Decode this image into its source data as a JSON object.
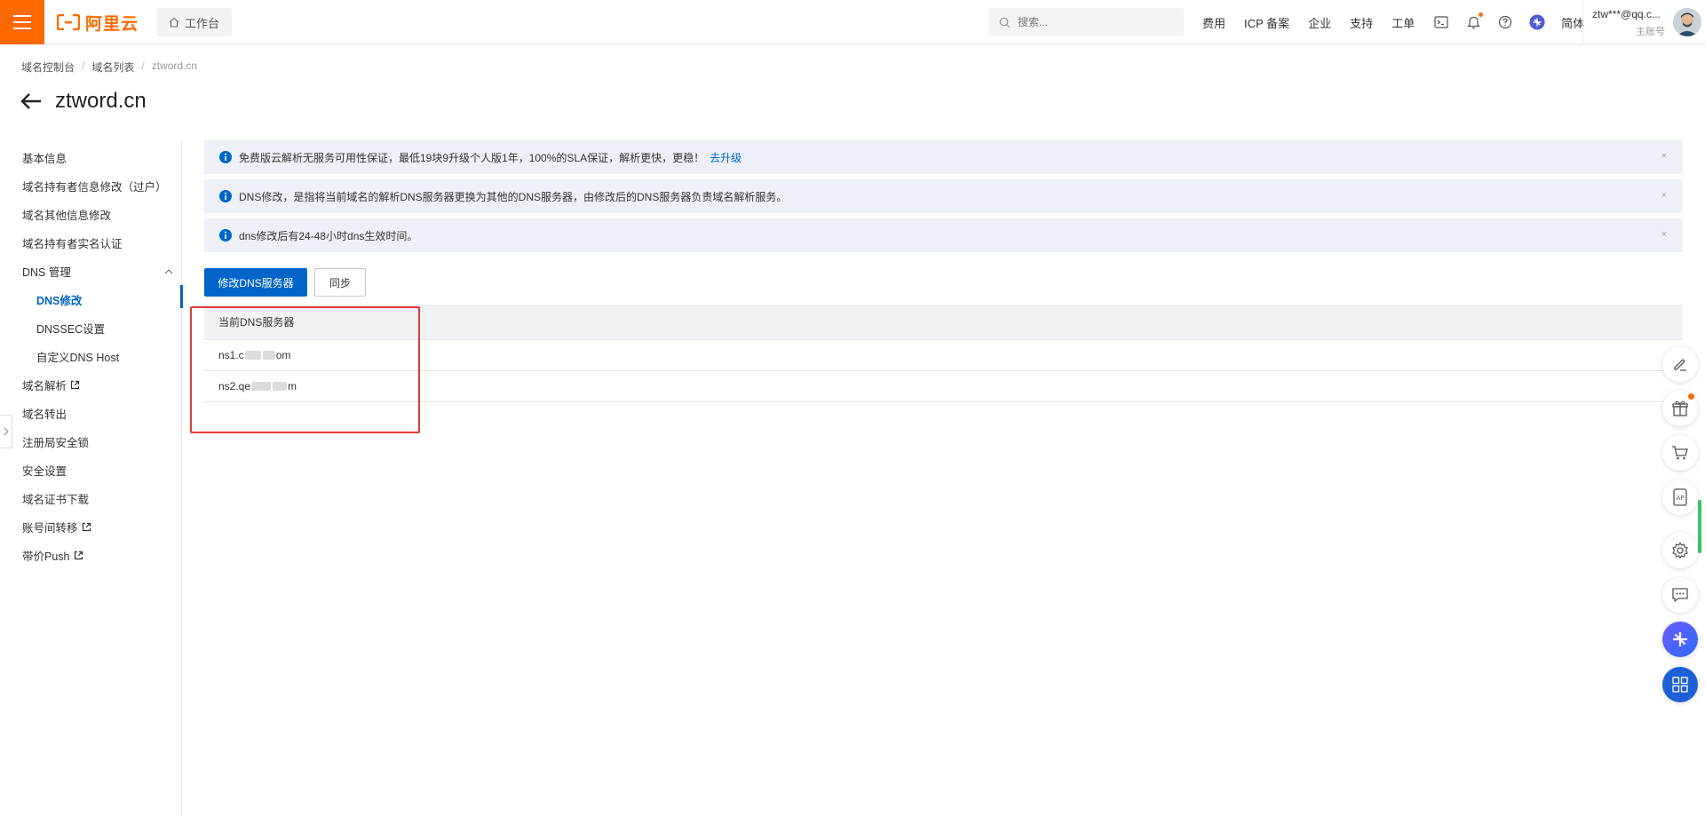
{
  "topbar": {
    "logo_text": "阿里云",
    "workbench": "工作台",
    "search_placeholder": "搜索...",
    "nav_links": [
      "费用",
      "ICP 备案",
      "企业",
      "支持",
      "工单"
    ],
    "lang": "简体",
    "user_name": "ztw***@qq.c...",
    "user_role": "主账号"
  },
  "breadcrumb": [
    "域名控制台",
    "域名列表",
    "ztword.cn"
  ],
  "page_title": "ztword.cn",
  "sidebar": {
    "items": [
      "基本信息",
      "域名持有者信息修改（过户）",
      "域名其他信息修改",
      "域名持有者实名认证",
      "DNS 管理",
      "DNS修改",
      "DNSSEC设置",
      "自定义DNS Host",
      "域名解析",
      "域名转出",
      "注册局安全锁",
      "安全设置",
      "域名证书下载",
      "账号间转移",
      "带价Push"
    ]
  },
  "alerts": [
    {
      "text": "免费版云解析无服务可用性保证，最低19块9升级个人版1年，100%的SLA保证，解析更快，更稳！",
      "link": "去升级"
    },
    {
      "text": "DNS修改，是指将当前域名的解析DNS服务器更换为其他的DNS服务器，由修改后的DNS服务器负责域名解析服务。",
      "link": ""
    },
    {
      "text": "dns修改后有24-48小时dns生效时间。",
      "link": ""
    }
  ],
  "buttons": {
    "modify_dns": "修改DNS服务器",
    "sync": "同步"
  },
  "table": {
    "header": "当前DNS服务器",
    "rows": [
      {
        "prefix": "ns1.c",
        "suffix": "om"
      },
      {
        "prefix": "ns2.qe",
        "suffix": "m"
      }
    ]
  },
  "colors": {
    "brand_orange": "#ff6a00",
    "primary_blue": "#0064c8",
    "alert_bg": "#edf1f7",
    "highlight_red": "#e53935"
  }
}
